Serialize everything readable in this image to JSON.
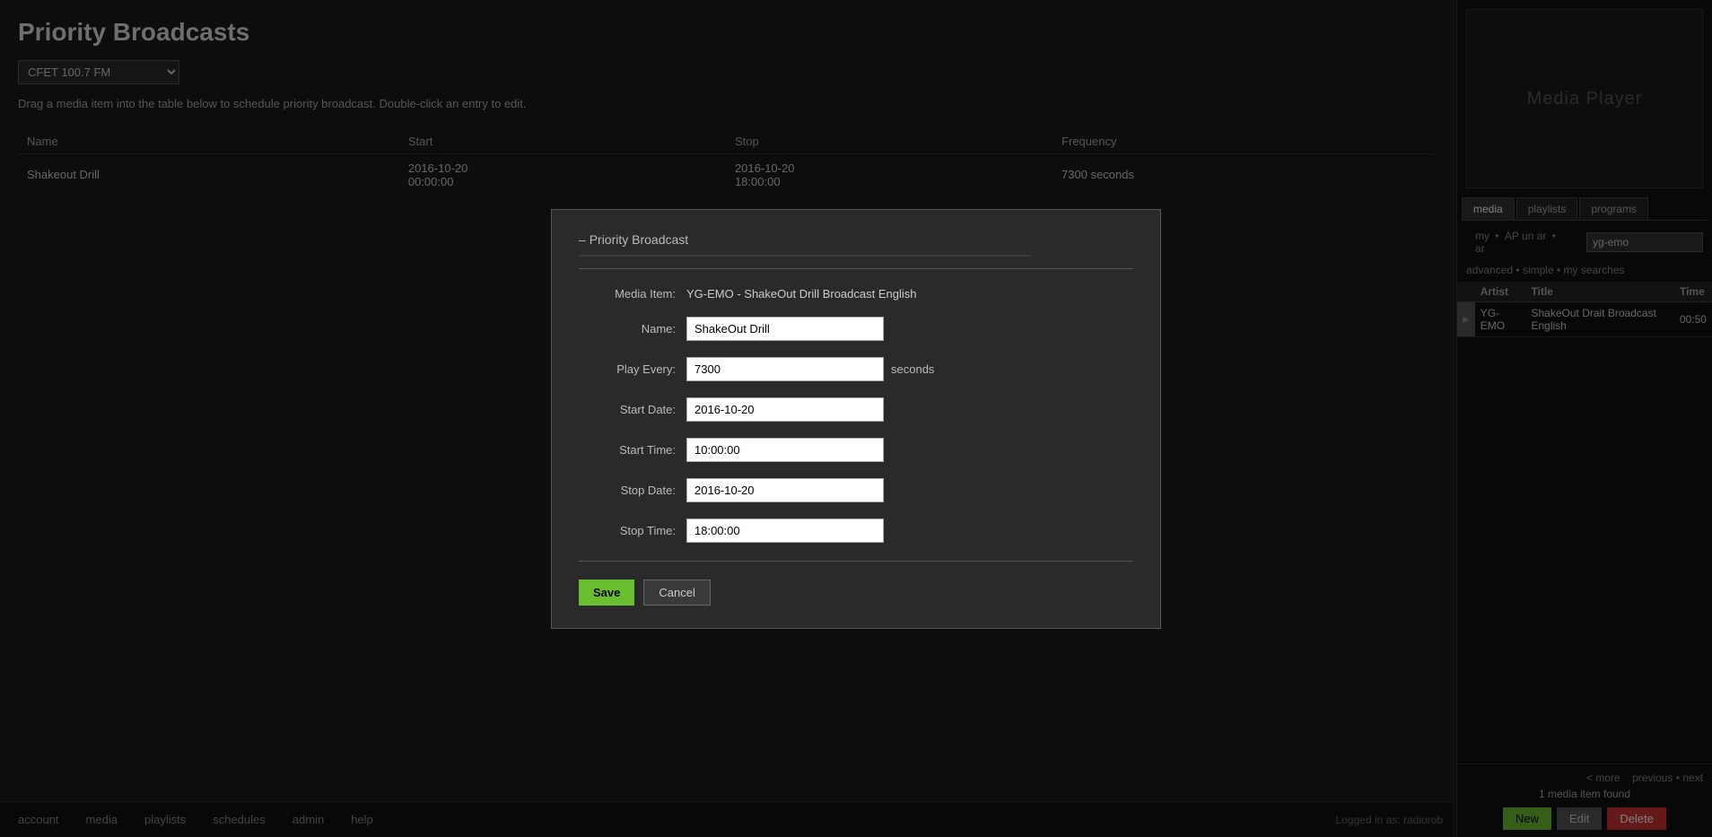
{
  "page": {
    "title": "Priority Broadcasts",
    "instructions": "Drag a media item into the table below to schedule priority broadcast. Double-click an entry to edit."
  },
  "station_select": {
    "value": "CFET 100.7 FM",
    "options": [
      "CFET 100.7 FM"
    ]
  },
  "table": {
    "columns": [
      "Name",
      "Start",
      "Stop",
      "Frequency"
    ],
    "rows": [
      {
        "name": "Shakeout Drill",
        "start": "2016-10-20\n00:00:00",
        "stop": "2016-10-20\n18:00:00",
        "frequency": "7300 seconds"
      }
    ]
  },
  "sidebar": {
    "media_player_label": "Media Player",
    "tabs": [
      "media",
      "playlists",
      "programs"
    ],
    "active_tab": "media",
    "search_links": {
      "my": "my",
      "bullet1": "•",
      "ap_un_ar": "AP un ar",
      "bullet2": "•",
      "ar": "ar"
    },
    "search_input_value": "yg-emo",
    "search_mode_links": {
      "advanced": "advanced",
      "bullet": "•",
      "simple": "simple",
      "bullet2": "•",
      "my_searches": "my searches"
    },
    "results_table": {
      "columns": [
        "Artist",
        "Title",
        "Time"
      ],
      "rows": [
        {
          "indicator": "▶",
          "artist": "YG-EMO",
          "title": "ShakeOut Drait Broadcast English",
          "time": "00:50"
        }
      ]
    },
    "footer": {
      "previous": "previous",
      "bullet": "•",
      "next": "next",
      "more": "< more",
      "count": "1 media item found"
    },
    "buttons": {
      "new": "New",
      "edit": "Edit",
      "delete": "Delete"
    }
  },
  "modal": {
    "title": "Priority Broadcast",
    "media_item_label": "Media Item:",
    "media_item_value": "YG-EMO - ShakeOut Drill Broadcast English",
    "name_label": "Name:",
    "name_value": "ShakeOut Drill",
    "play_every_label": "Play Every:",
    "play_every_value": "7300",
    "seconds_label": "seconds",
    "start_date_label": "Start Date:",
    "start_date_value": "2016-10-20",
    "start_time_label": "Start Time:",
    "start_time_value": "10:00:00",
    "stop_date_label": "Stop Date:",
    "stop_date_value": "2016-10-20",
    "stop_time_label": "Stop Time:",
    "stop_time_value": "18:00:00",
    "save_button": "Save",
    "cancel_button": "Cancel"
  },
  "bottom_nav": {
    "links": [
      "account",
      "media",
      "playlists",
      "schedules",
      "admin",
      "help"
    ]
  },
  "logged_in": "Logged in as: radiorob"
}
